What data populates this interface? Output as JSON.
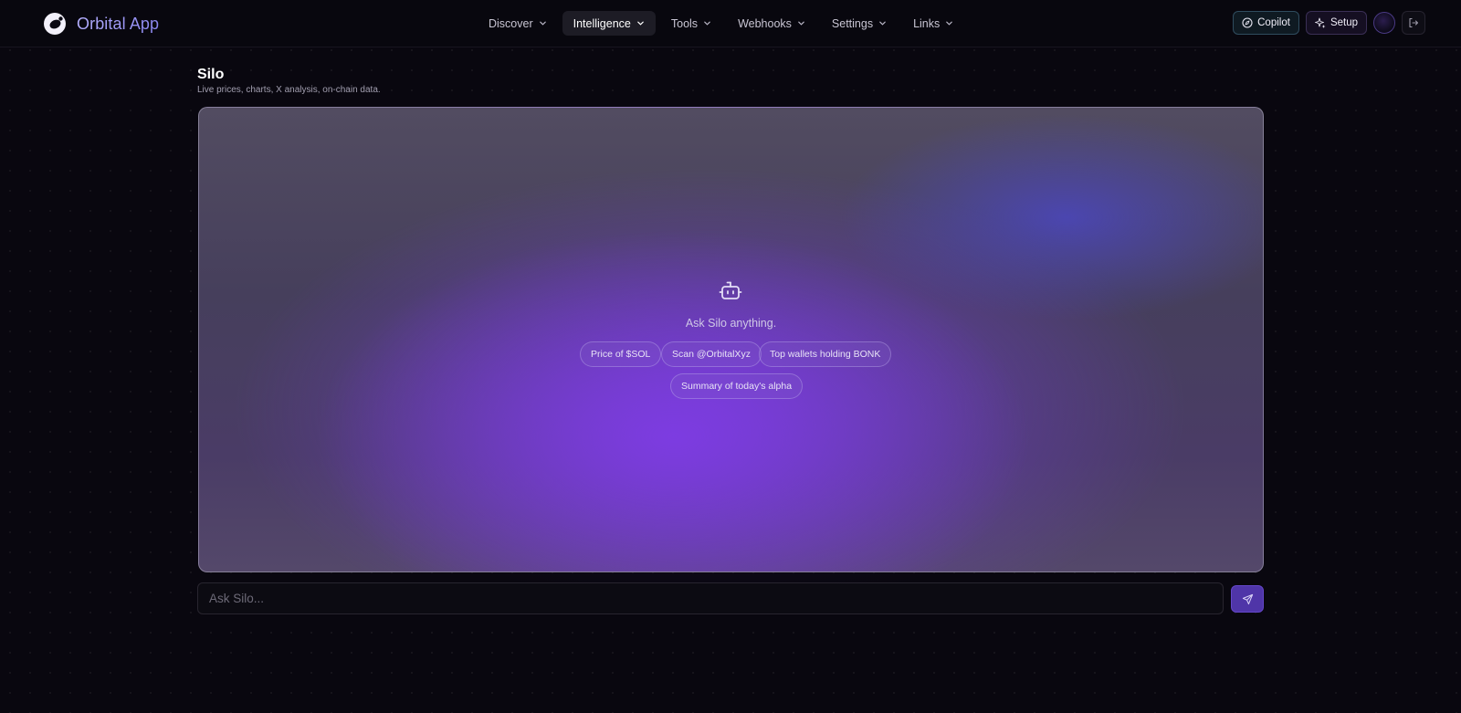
{
  "app": {
    "name": "Orbital App"
  },
  "nav": {
    "items": [
      {
        "label": "Discover"
      },
      {
        "label": "Intelligence",
        "active": true
      },
      {
        "label": "Tools"
      },
      {
        "label": "Webhooks"
      },
      {
        "label": "Settings"
      },
      {
        "label": "Links"
      }
    ]
  },
  "header_actions": {
    "copilot_label": "Copilot",
    "setup_label": "Setup",
    "avatar_icon": "user-avatar",
    "logout_icon": "logout-icon"
  },
  "page": {
    "title": "Silo",
    "subtitle": "Live prices, charts, X analysis, on-chain data."
  },
  "chat": {
    "empty_prompt": "Ask Silo anything.",
    "suggestions": [
      "Price of $SOL",
      "Scan @OrbitalXyz",
      "Top wallets holding BONK",
      "Summary of today's alpha"
    ],
    "input_placeholder": "Ask Silo...",
    "input_value": "",
    "send_icon": "send-icon"
  },
  "colors": {
    "accent": "#7c3aed",
    "brand_text": "#a9a3ff",
    "send_button": "#4f35a8"
  }
}
